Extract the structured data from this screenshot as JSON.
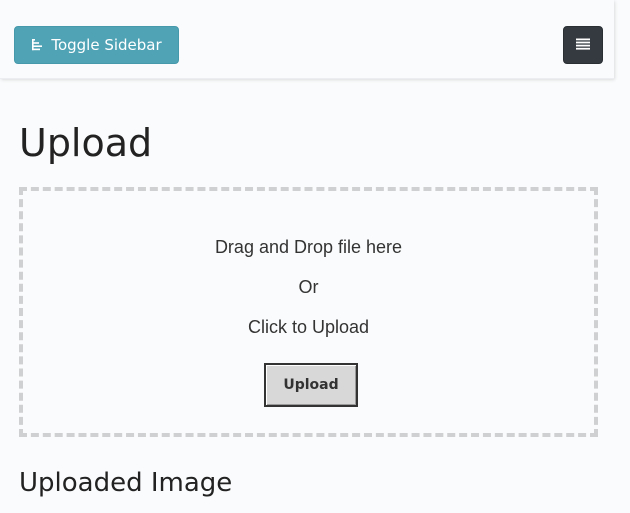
{
  "navbar": {
    "toggle_label": "Toggle Sidebar",
    "toggle_icon": "align-left-icon",
    "menu_icon": "menu-icon",
    "toggle_color": "#4fa3b5",
    "menu_color": "#343a40"
  },
  "page": {
    "title": "Upload"
  },
  "dropzone": {
    "drag_text": "Drag and Drop file here",
    "or_text": "Or",
    "click_text": "Click to Upload",
    "upload_label": "Upload"
  },
  "uploaded": {
    "title": "Uploaded Image"
  }
}
